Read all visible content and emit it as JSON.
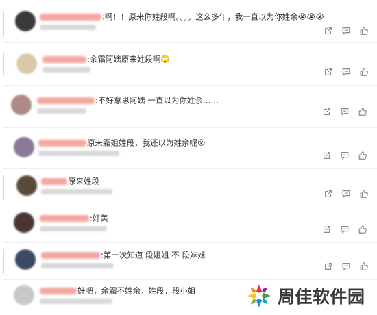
{
  "comments": [
    {
      "text": ":啊！！原来你姓段啊。。。。这么多年，我一直以为你姓余",
      "emoji": "😭😭😭",
      "avatar_color": "#3a3a3a"
    },
    {
      "text": ":余霜阿姨原来姓段啊",
      "emoji": "🙄",
      "avatar_color": "#d8c9a8"
    },
    {
      "text": ":不好意思阿姨 一直以为你姓余……",
      "emoji": "",
      "avatar_color": "#b08a86"
    },
    {
      "text": "原来霜姐姓段，我还以为姓余呢",
      "emoji": "😮",
      "avatar_color": "#8a7a9a"
    },
    {
      "text": "原来姓段",
      "emoji": "",
      "avatar_color": "#5a4a3a"
    },
    {
      "text": ":好美",
      "emoji": "",
      "avatar_color": "#4a3434"
    },
    {
      "text": ":第一次知道 段姐姐 不 段妹妹",
      "emoji": "",
      "avatar_color": "#3b4a63"
    },
    {
      "text": "好吧，余霜不姓余，姓段，段小姐",
      "emoji": "",
      "avatar_color": "#c8c8c8"
    }
  ],
  "icons": {
    "share": "share-icon",
    "reply": "comment-icon",
    "like": "like-icon"
  },
  "colors": {
    "username": "#f28b82",
    "meta": "#d9d9d9",
    "icon": "#8a8a8a"
  },
  "watermark": {
    "text": "周佳软件园"
  }
}
